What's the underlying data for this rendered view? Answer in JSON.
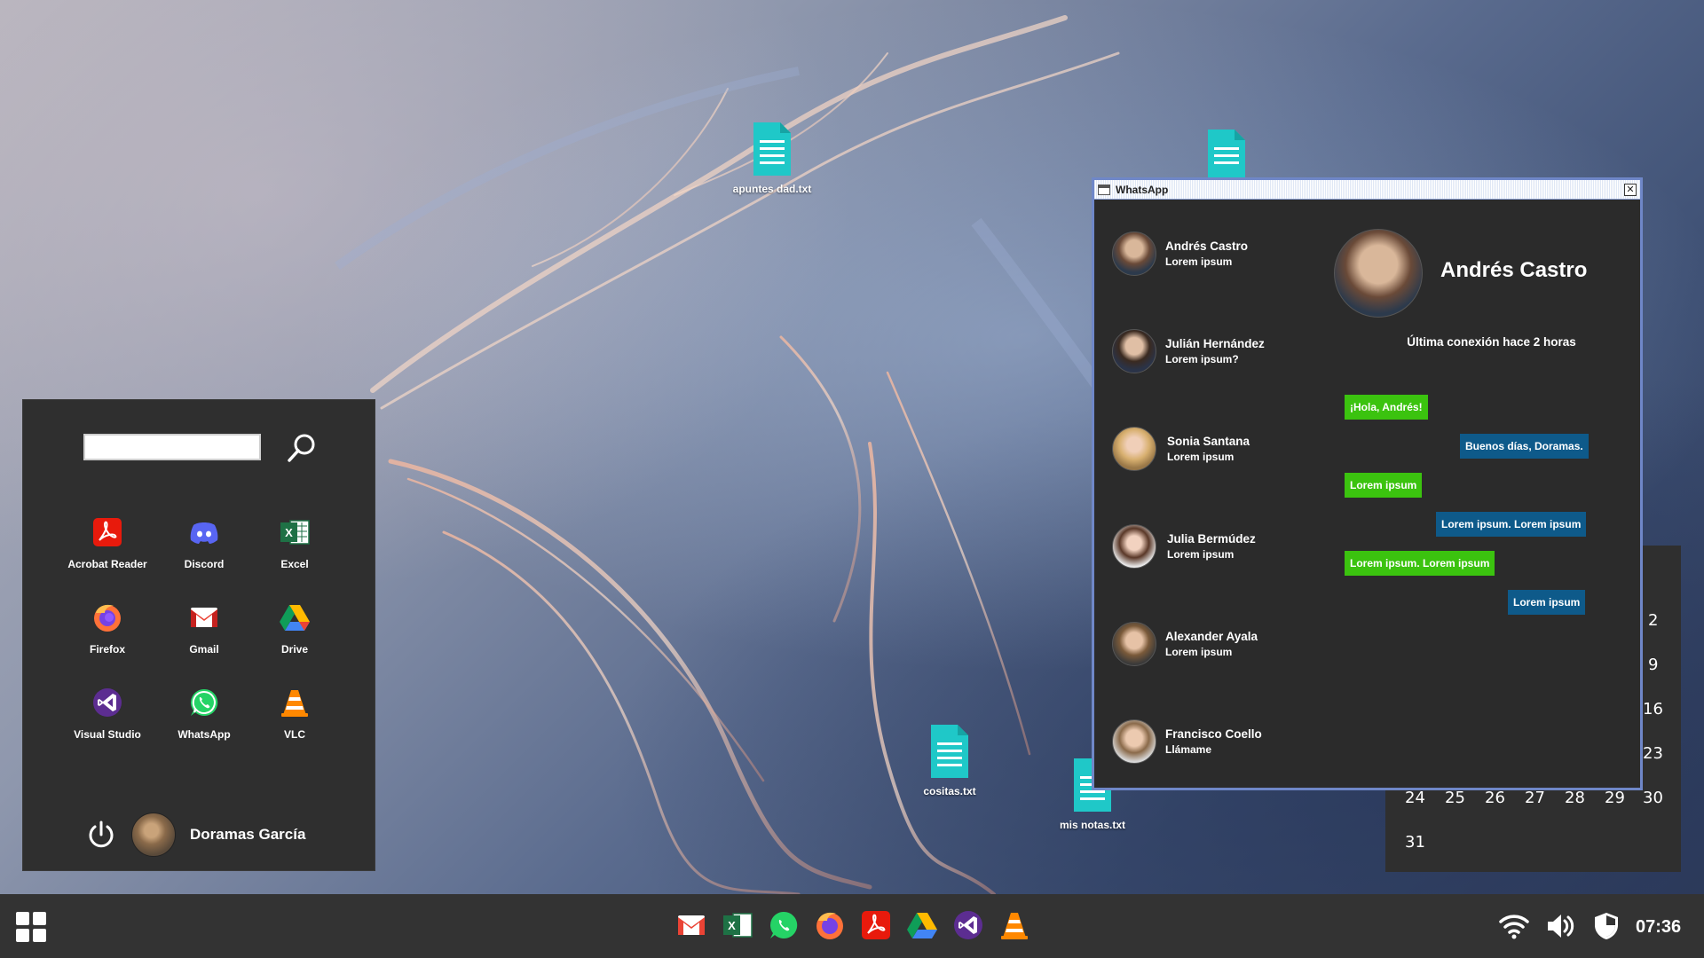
{
  "desktop": {
    "files": [
      {
        "label": "apuntes dad.txt"
      },
      {
        "label": ""
      },
      {
        "label": "cositas.txt"
      },
      {
        "label": "mis notas.txt"
      }
    ]
  },
  "start_menu": {
    "search": {
      "value": "",
      "placeholder": ""
    },
    "apps": [
      {
        "label": "Acrobat Reader",
        "icon": "acrobat-icon"
      },
      {
        "label": "Discord",
        "icon": "discord-icon"
      },
      {
        "label": "Excel",
        "icon": "excel-icon"
      },
      {
        "label": "Firefox",
        "icon": "firefox-icon"
      },
      {
        "label": "Gmail",
        "icon": "gmail-icon"
      },
      {
        "label": "Drive",
        "icon": "drive-icon"
      },
      {
        "label": "Visual Studio",
        "icon": "visual-studio-icon"
      },
      {
        "label": "WhatsApp",
        "icon": "whatsapp-icon"
      },
      {
        "label": "VLC",
        "icon": "vlc-icon"
      }
    ],
    "user_name": "Doramas García"
  },
  "whatsapp": {
    "title": "WhatsApp",
    "contacts": [
      {
        "name": "Andrés Castro",
        "last": "Lorem ipsum"
      },
      {
        "name": "Julián Hernández",
        "last": "Lorem ipsum?"
      },
      {
        "name": "Sonia Santana",
        "last": "Lorem ipsum"
      },
      {
        "name": "Julia Bermúdez",
        "last": "Lorem ipsum"
      },
      {
        "name": "Alexander Ayala",
        "last": "Lorem ipsum"
      },
      {
        "name": "Francisco Coello",
        "last": "Llámame"
      }
    ],
    "chat": {
      "name": "Andrés Castro",
      "status": "Última conexión hace 2 horas",
      "messages": [
        {
          "dir": "in",
          "text": "¡Hola, Andrés!"
        },
        {
          "dir": "out",
          "text": "Buenos días, Doramas."
        },
        {
          "dir": "in",
          "text": "Lorem ipsum"
        },
        {
          "dir": "out",
          "text": "Lorem ipsum. Lorem ipsum"
        },
        {
          "dir": "in",
          "text": "Lorem ipsum. Lorem ipsum"
        },
        {
          "dir": "out",
          "text": "Lorem ipsum"
        }
      ]
    }
  },
  "calendar": {
    "visible_days": [
      "2",
      "9",
      "16",
      "23",
      "24",
      "25",
      "26",
      "27",
      "28",
      "29",
      "30",
      "31"
    ]
  },
  "taskbar": {
    "pinned": [
      "gmail-icon",
      "excel-icon",
      "whatsapp-icon",
      "firefox-icon",
      "acrobat-icon",
      "drive-icon",
      "visual-studio-icon",
      "vlc-icon"
    ],
    "tray": [
      "wifi-icon",
      "volume-icon",
      "shield-icon"
    ],
    "clock": "07:36"
  },
  "colors": {
    "incoming_bubble": "#3bc30f",
    "outgoing_bubble": "#0e5a8a",
    "panel_bg": "#2f2f2f",
    "taskbar_bg": "#333333"
  }
}
